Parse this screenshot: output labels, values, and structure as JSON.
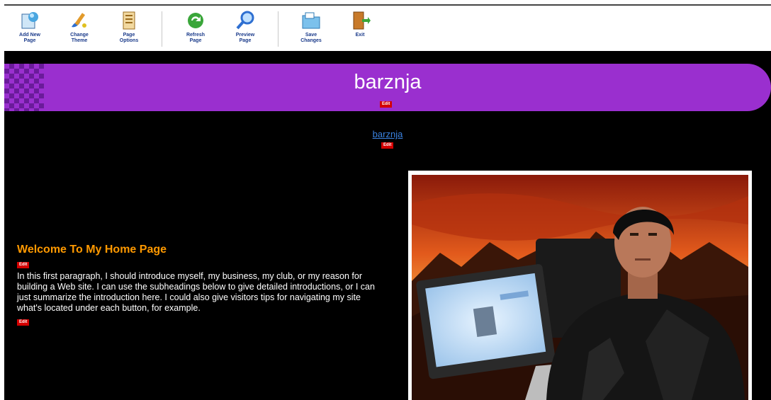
{
  "toolbar": {
    "items": [
      {
        "label": "Add New\nPage",
        "icon": "add-page-icon"
      },
      {
        "label": "Change\nTheme",
        "icon": "paintbrush-icon"
      },
      {
        "label": "Page\nOptions",
        "icon": "page-options-icon"
      },
      {
        "label": "Refresh\nPage",
        "icon": "refresh-icon"
      },
      {
        "label": "Preview\nPage",
        "icon": "magnifier-icon"
      },
      {
        "label": "Save\nChanges",
        "icon": "save-folder-icon"
      },
      {
        "label": "Exit",
        "icon": "exit-door-icon"
      }
    ]
  },
  "site": {
    "title": "barznja",
    "edit_label": "Edit",
    "nav_link": "barznja",
    "colors": {
      "banner": "#9a2fcf",
      "heading": "#ff9900",
      "link": "#3a82e0",
      "edit": "#d40000"
    }
  },
  "main": {
    "heading": "Welcome To My Home Page",
    "paragraph": "In this first paragraph, I should introduce myself, my business, my club, or my reason for building a Web site. I can use the subheadings below to give detailed introductions, or I can just summarize the introduction here. I could also give visitors tips for navigating my site what's located under each button, for example."
  }
}
